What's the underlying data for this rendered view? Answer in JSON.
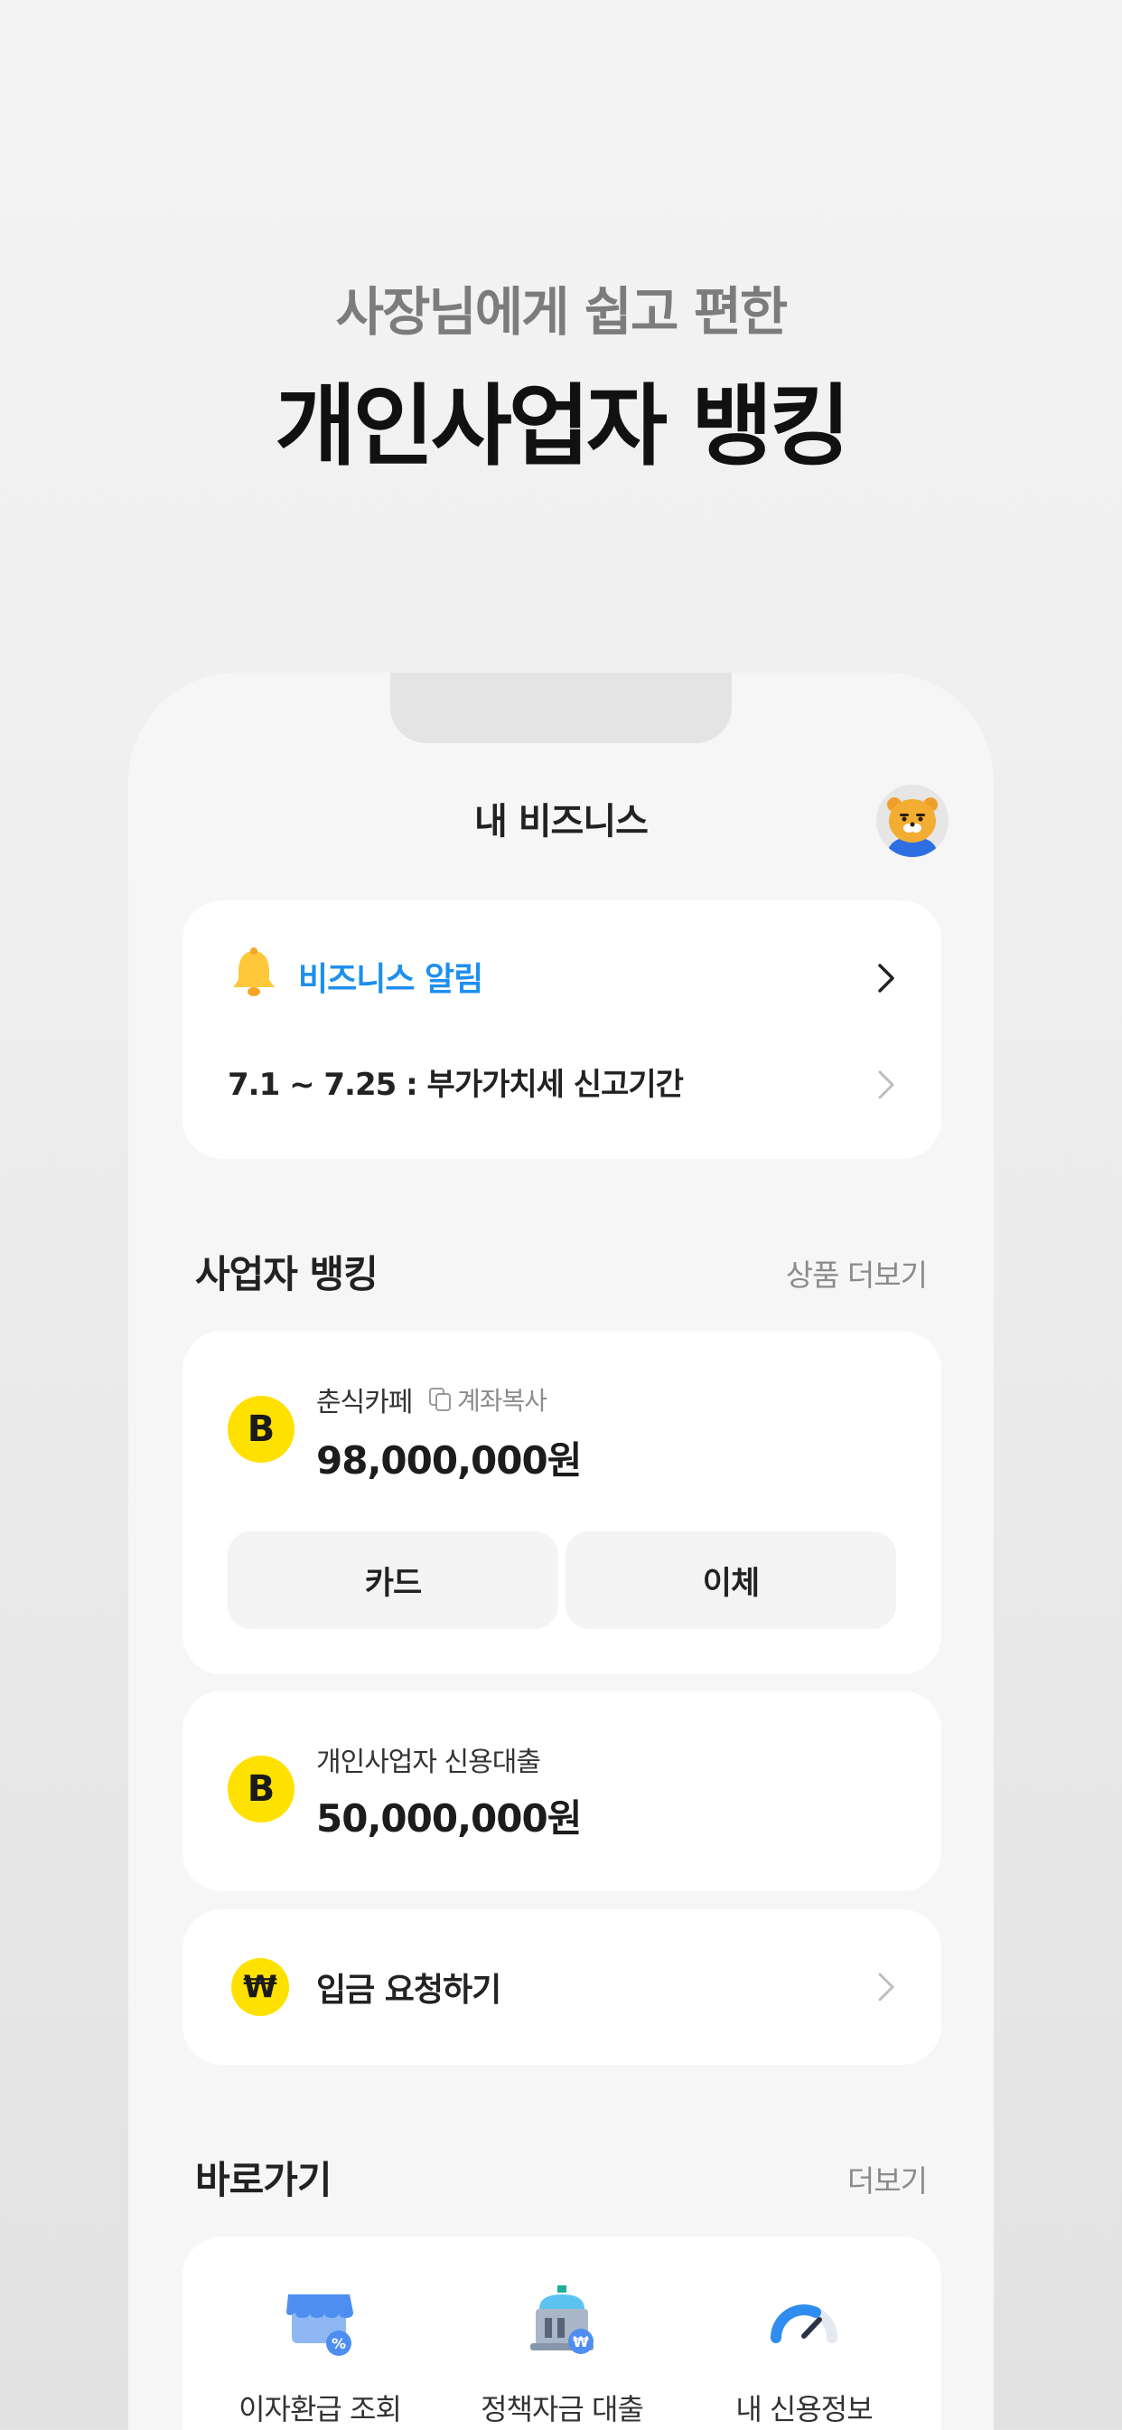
{
  "promo": {
    "subtitle": "사장님에게 쉽고 편한",
    "title": "개인사업자 뱅킹"
  },
  "nav": {
    "title": "내 비즈니스",
    "avatar_icon": "ryan-character-avatar"
  },
  "alarm": {
    "icon": "bell-icon",
    "title": "비즈니스 알림",
    "item": "7.1 ~ 7.25 : 부가가치세 신고기간",
    "accent_color": "#1d8ff0"
  },
  "banking": {
    "section_title": "사업자 뱅킹",
    "more_link": "상품 더보기",
    "account": {
      "name": "춘식카페",
      "copy_label": "계좌복사",
      "amount": "98,000,000원",
      "logo_letter": "B",
      "card_button": "카드",
      "transfer_button": "이체"
    },
    "loan": {
      "name": "개인사업자 신용대출",
      "amount": "50,000,000원",
      "logo_letter": "B"
    },
    "deposit_request": {
      "icon_symbol": "₩",
      "label": "입금 요청하기"
    },
    "brand_color": "#ffe100"
  },
  "shortcuts": {
    "section_title": "바로가기",
    "more_link": "더보기",
    "items": [
      {
        "label": "이자환급 조회",
        "icon": "store-percent-icon"
      },
      {
        "label": "정책자금 대출",
        "icon": "government-building-icon"
      },
      {
        "label": "내 신용정보",
        "icon": "credit-gauge-icon"
      }
    ]
  }
}
